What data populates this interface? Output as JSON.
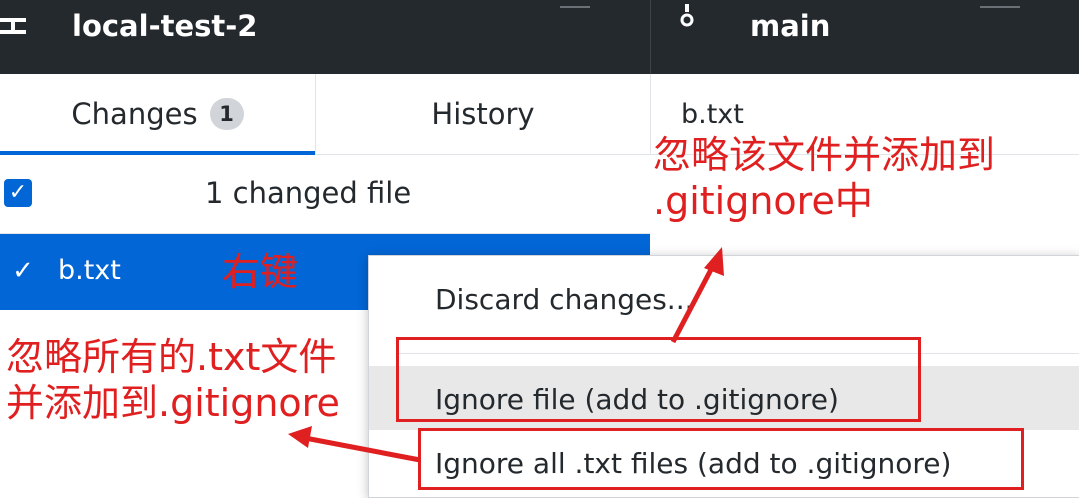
{
  "topbar": {
    "repository_name": "local-test-2",
    "branch_name": "main",
    "icons": {
      "repository": "repository-icon",
      "branch": "git-branch-icon"
    }
  },
  "tabs": {
    "changes_label": "Changes",
    "changes_count": "1",
    "history_label": "History"
  },
  "file_header": {
    "name": "b.txt"
  },
  "changes_list": {
    "summary": "1 changed file",
    "files": [
      {
        "name": "b.txt",
        "checked": true
      }
    ]
  },
  "context_menu": {
    "items": [
      {
        "label": "Discard changes..."
      },
      {
        "label": "Ignore file (add to .gitignore)"
      },
      {
        "label": "Ignore all .txt files (add to .gitignore)"
      }
    ]
  },
  "annotations": {
    "ignore_file_line1": "忽略该文件并添加到",
    "ignore_file_line2": ".gitignore中",
    "right_click": "右键",
    "ignore_all_line1": "忽略所有的.txt文件",
    "ignore_all_line2": "并添加到.gitignore"
  },
  "colors": {
    "topbar_bg": "#24292e",
    "accent_blue": "#0366d6",
    "annotation_red": "#e02020",
    "menu_hover": "#e8e8e8"
  }
}
